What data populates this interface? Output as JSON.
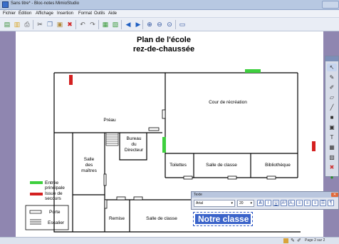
{
  "window": {
    "title": "Sans titre* - Bloc-notes MimioStudio"
  },
  "menu": [
    "Fichier",
    "Édition",
    "Affichage",
    "Insertion",
    "Format",
    "Outils",
    "Aide"
  ],
  "toolbar_icons": [
    {
      "name": "new-icon",
      "glyph": "▤",
      "color": "#3b8f3b"
    },
    {
      "name": "open-icon",
      "glyph": "▥",
      "color": "#d8a420"
    },
    {
      "name": "print-icon",
      "glyph": "⎙",
      "color": "#555555"
    },
    {
      "name": "cut-icon",
      "glyph": "✂",
      "color": "#444444"
    },
    {
      "name": "copy-icon",
      "glyph": "❐",
      "color": "#5577aa"
    },
    {
      "name": "paste-icon",
      "glyph": "▣",
      "color": "#b08a3a"
    },
    {
      "name": "delete-icon",
      "glyph": "✖",
      "color": "#d02a2a"
    },
    {
      "name": "undo-icon",
      "glyph": "↶",
      "color": "#666666"
    },
    {
      "name": "redo-icon",
      "glyph": "↷",
      "color": "#666666"
    },
    {
      "name": "insert-page-icon",
      "glyph": "▦",
      "color": "#3a9a3a"
    },
    {
      "name": "delete-page-icon",
      "glyph": "▧",
      "color": "#3a9a3a"
    },
    {
      "name": "previous-page-icon",
      "glyph": "◀",
      "color": "#1f5fc2"
    },
    {
      "name": "next-page-icon",
      "glyph": "▶",
      "color": "#1f5fc2"
    },
    {
      "name": "zoom-in-icon",
      "glyph": "⊕",
      "color": "#2a4f9c"
    },
    {
      "name": "zoom-out-icon",
      "glyph": "⊖",
      "color": "#2a4f9c"
    },
    {
      "name": "zoom-fit-icon",
      "glyph": "⊙",
      "color": "#2a4f9c"
    },
    {
      "name": "screen-icon",
      "glyph": "▭",
      "color": "#2a4f9c"
    }
  ],
  "plan": {
    "title_line1": "Plan de l'école",
    "title_line2": "rez-de-chaussée",
    "rooms": {
      "preau": "Préau",
      "cour": "Cour de récréation",
      "bureau1": "Bureau",
      "bureau2": "du",
      "bureau3": "Directeur",
      "salle_maitres1": "Salle",
      "salle_maitres2": "des",
      "salle_maitres3": "maîtres",
      "toilettes": "Toilettes",
      "salle_classe_1": "Salle de classe",
      "bibliotheque": "Bibliothèque",
      "remise": "Remise",
      "salle_classe_2": "Salle de classe"
    },
    "legend": {
      "entree1": "Entrée",
      "entree2": "principale",
      "secours1": "Issue de",
      "secours2": "secours",
      "porte": "Porte",
      "escalier": "Escalier"
    },
    "colors": {
      "entree": "#3ecf3e",
      "secours": "#d42020"
    }
  },
  "text_toolbar": {
    "title": "Texte",
    "font": "Arial",
    "size": "20",
    "format_buttons": [
      "A",
      "I",
      "U",
      "A²",
      "A₂",
      "≡",
      "≡",
      "≡",
      "☰",
      "¶"
    ]
  },
  "text_box": {
    "value": "Notre classe"
  },
  "status": {
    "page": "Page 2 sur 2"
  }
}
